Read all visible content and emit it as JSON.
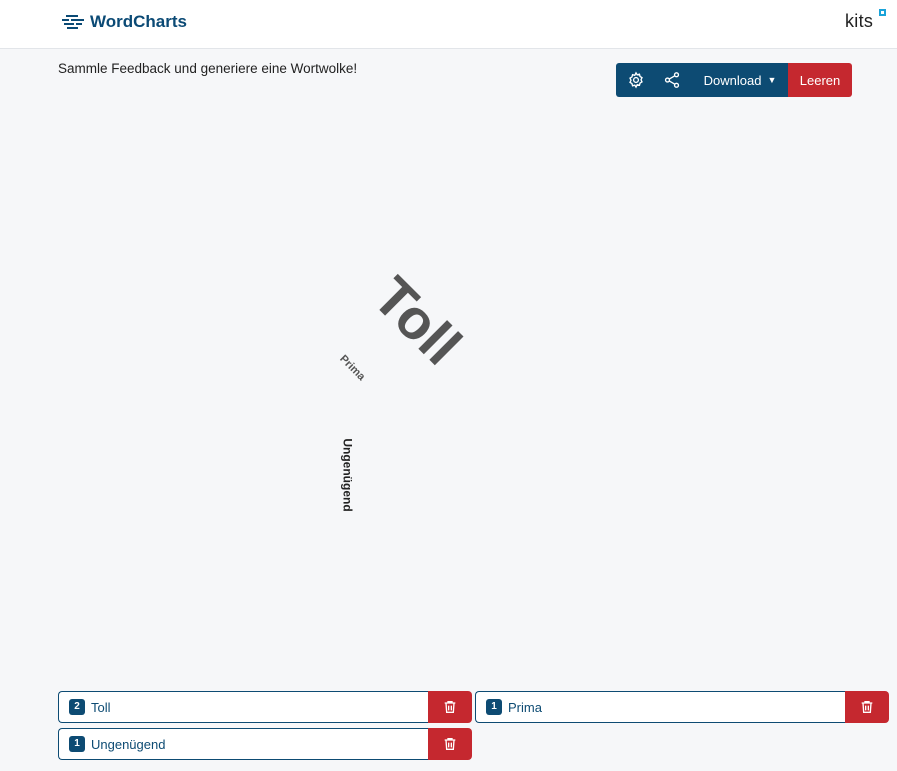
{
  "header": {
    "app_name": "WordCharts",
    "brand_right": "kits"
  },
  "subtitle": "Sammle Feedback und generiere eine Wortwolke!",
  "toolbar": {
    "download_label": "Download",
    "clear_label": "Leeren"
  },
  "cloud": {
    "words": [
      "Toll",
      "Prima",
      "Ungenügend"
    ]
  },
  "entries": [
    {
      "count": "2",
      "text": "Toll"
    },
    {
      "count": "1",
      "text": "Prima"
    },
    {
      "count": "1",
      "text": "Ungenügend"
    }
  ],
  "colors": {
    "primary": "#0d4b73",
    "danger": "#c5282f",
    "word_gray": "#555555",
    "background": "#f6f7f9"
  }
}
